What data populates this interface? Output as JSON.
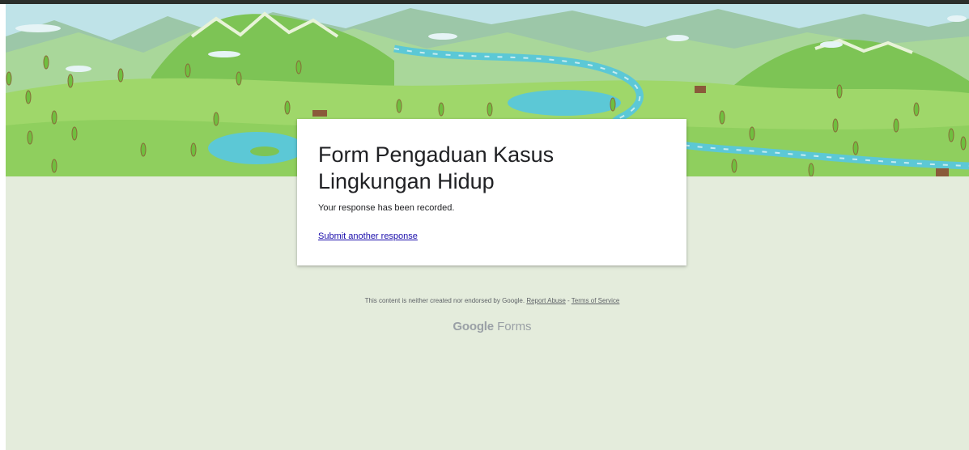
{
  "form": {
    "title": "Form Pengaduan Kasus Lingkungan Hidup",
    "confirmation_message": "Your response has been recorded.",
    "submit_another_label": "Submit another response"
  },
  "footer": {
    "disclaimer": "This content is neither created nor endorsed by Google.",
    "report_abuse_label": "Report Abuse",
    "separator": " - ",
    "terms_label": "Terms of Service"
  },
  "brand": {
    "google": "Google",
    "forms": "Forms"
  },
  "colors": {
    "page_background": "#e4ecdc",
    "card_background": "#ffffff",
    "link": "#1a0dab",
    "hill_green": "#8fcf5e",
    "water": "#5cc8d6"
  }
}
